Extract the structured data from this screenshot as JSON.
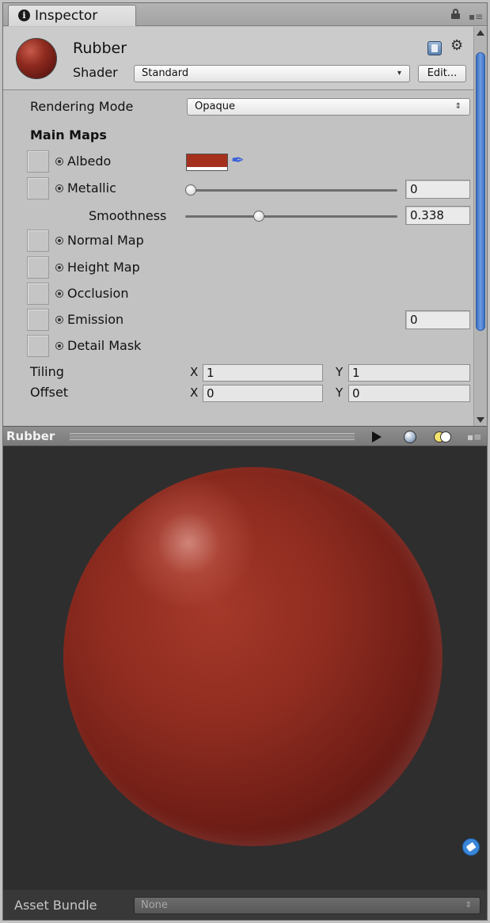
{
  "window": {
    "tab_title": "Inspector"
  },
  "material": {
    "name": "Rubber",
    "shader_label": "Shader",
    "shader_value": "Standard",
    "edit_label": "Edit..."
  },
  "properties": {
    "rendering_mode_label": "Rendering Mode",
    "rendering_mode_value": "Opaque",
    "section_main_maps": "Main Maps",
    "albedo_label": "Albedo",
    "albedo_color": "#a5301d",
    "metallic_label": "Metallic",
    "metallic_value": "0",
    "metallic_fraction": 0,
    "smoothness_label": "Smoothness",
    "smoothness_value": "0.338",
    "smoothness_fraction": 0.338,
    "normal_map_label": "Normal Map",
    "height_map_label": "Height Map",
    "occlusion_label": "Occlusion",
    "emission_label": "Emission",
    "emission_value": "0",
    "detail_mask_label": "Detail Mask",
    "tiling_label": "Tiling",
    "tiling_x": "1",
    "tiling_y": "1",
    "offset_label": "Offset",
    "offset_x": "0",
    "offset_y": "0",
    "axis_x": "X",
    "axis_y": "Y"
  },
  "preview": {
    "title": "Rubber"
  },
  "asset_bundle": {
    "label": "Asset Bundle",
    "value": "None"
  },
  "icons": {
    "info": "info-icon",
    "lock": "lock-icon",
    "menu": "panel-menu-icon",
    "book": "help-book-icon",
    "gear": "gear-icon",
    "dropper": "eyedropper-icon",
    "play": "play-icon",
    "sphere": "sphere-preview-icon",
    "light": "light-toggle-icon",
    "tag": "tag-icon"
  },
  "colors": {
    "accent": "#3a6fbf",
    "material": "#8f2c20",
    "preview_bg": "#2e2e2e"
  }
}
